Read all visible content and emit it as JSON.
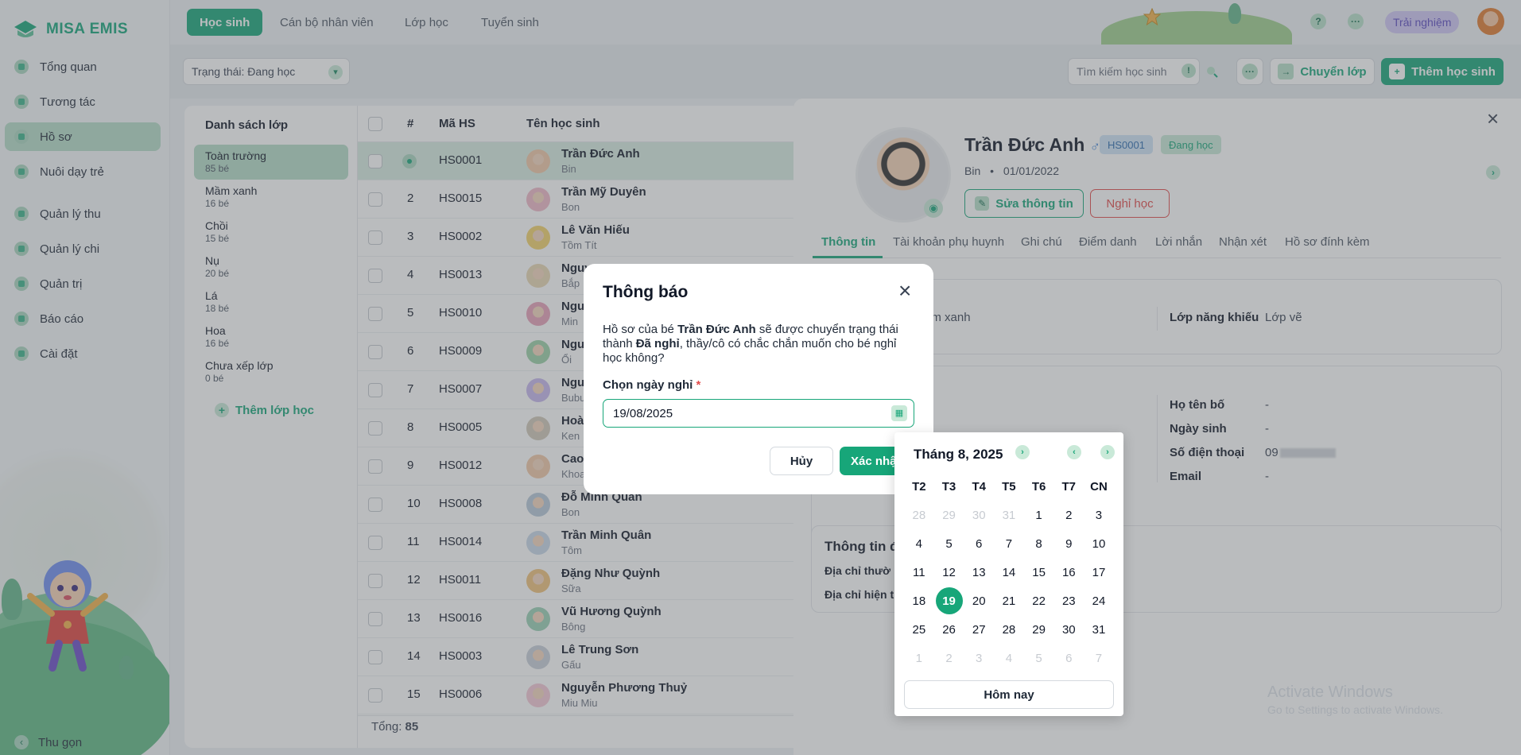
{
  "app": {
    "logo_text": "MISA EMIS"
  },
  "sidebar": {
    "items": [
      {
        "label": "Tổng quan",
        "icon": "dashboard-icon"
      },
      {
        "label": "Tương tác",
        "icon": "send-icon"
      },
      {
        "label": "Hồ sơ",
        "icon": "folder-icon"
      },
      {
        "label": "Nuôi dạy trẻ",
        "icon": "heart-icon"
      },
      {
        "label": "Quản lý thu",
        "icon": "income-icon"
      },
      {
        "label": "Quản lý chi",
        "icon": "wallet-icon"
      },
      {
        "label": "Quản trị",
        "icon": "briefcase-icon"
      },
      {
        "label": "Báo cáo",
        "icon": "report-icon"
      },
      {
        "label": "Cài đặt",
        "icon": "gear-icon"
      }
    ],
    "collapse_label": "Thu gọn"
  },
  "topbar": {
    "tabs": [
      "Học sinh",
      "Cán bộ nhân viên",
      "Lớp học",
      "Tuyển sinh"
    ],
    "help": "?",
    "more": "···",
    "trial": "Trải nghiệm"
  },
  "filter": {
    "status": "Trạng thái: Đang học",
    "search_placeholder": "Tìm kiếm học sinh",
    "more": "···",
    "move_class": "Chuyển lớp",
    "add_student": "Thêm học sinh"
  },
  "classes": {
    "title": "Danh sách lớp",
    "items": [
      {
        "name": "Toàn trường",
        "count": "85 bé"
      },
      {
        "name": "Mầm xanh",
        "count": "16 bé"
      },
      {
        "name": "Chồi",
        "count": "15 bé"
      },
      {
        "name": "Nụ",
        "count": "20 bé"
      },
      {
        "name": "Lá",
        "count": "18 bé"
      },
      {
        "name": "Hoa",
        "count": "16 bé"
      },
      {
        "name": "Chưa xếp lớp",
        "count": "0 bé"
      }
    ],
    "add_label": "Thêm lớp học"
  },
  "table": {
    "headers": {
      "no": "#",
      "code": "Mã HS",
      "name": "Tên học sinh"
    },
    "rows": [
      {
        "no": "",
        "code": "HS0001",
        "name": "Trần Đức Anh",
        "nick": "Bin"
      },
      {
        "no": "2",
        "code": "HS0015",
        "name": "Trần Mỹ Duyên",
        "nick": "Bon"
      },
      {
        "no": "3",
        "code": "HS0002",
        "name": "Lê Văn Hiếu",
        "nick": "Tồm Tít"
      },
      {
        "no": "4",
        "code": "HS0013",
        "name": "Nguy",
        "nick": "Bắp"
      },
      {
        "no": "5",
        "code": "HS0010",
        "name": "Ngu",
        "nick": "Min"
      },
      {
        "no": "6",
        "code": "HS0009",
        "name": "Ngu",
        "nick": "Ổi"
      },
      {
        "no": "7",
        "code": "HS0007",
        "name": "Ngu",
        "nick": "Bubu"
      },
      {
        "no": "8",
        "code": "HS0005",
        "name": "Hoà",
        "nick": "Ken"
      },
      {
        "no": "9",
        "code": "HS0012",
        "name": "Cao",
        "nick": "Khoa"
      },
      {
        "no": "10",
        "code": "HS0008",
        "name": "Đỗ Minh Quân",
        "nick": "Bon"
      },
      {
        "no": "11",
        "code": "HS0014",
        "name": "Trần Minh Quân",
        "nick": "Tôm"
      },
      {
        "no": "12",
        "code": "HS0011",
        "name": "Đặng Như Quỳnh",
        "nick": "Sữa"
      },
      {
        "no": "13",
        "code": "HS0016",
        "name": "Vũ Hương Quỳnh",
        "nick": "Bông"
      },
      {
        "no": "14",
        "code": "HS0003",
        "name": "Lê Trung Sơn",
        "nick": "Gấu"
      },
      {
        "no": "15",
        "code": "HS0006",
        "name": "Nguyễn Phương Thuỷ",
        "nick": "Miu Miu"
      }
    ],
    "total_label": "Tổng:",
    "total_value": "85"
  },
  "detail": {
    "name": "Trần Đức Anh",
    "gender_symbol": "♂",
    "code": "HS0001",
    "status": "Đang học",
    "nick": "Bin",
    "dob": "01/01/2022",
    "edit_label": "Sửa thông tin",
    "quit_label": "Nghỉ học",
    "tabs": [
      "Thông tin",
      "Tài khoản phụ huynh",
      "Ghi chú",
      "Điểm danh",
      "Lời nhắn",
      "Nhận xét",
      "Hồ sơ đính kèm"
    ],
    "class_partial": "ầm xanh",
    "talent_label": "Lớp năng khiếu",
    "talent_value": "Lớp vẽ",
    "father_label": "Họ tên bố",
    "father_value": "-",
    "birth_label": "Ngày sinh",
    "birth_value": "-",
    "phone_label": "Số điện thoại",
    "phone_value": "09",
    "email_label": "Email",
    "email_value": "-",
    "address_section": "Thông tin đ",
    "addr1": "Địa chỉ thườ",
    "addr2": "Địa chỉ hiện t"
  },
  "dialog": {
    "title": "Thông báo",
    "msg_1": "Hồ sơ của bé ",
    "msg_name": "Trần Đức Anh",
    "msg_2": " sẽ được chuyển trạng thái thành ",
    "msg_status": "Đã nghỉ",
    "msg_3": ", thầy/cô có chắc chắn muốn cho bé nghỉ học không?",
    "date_label": "Chọn ngày nghỉ",
    "required": "*",
    "date_value": "19/08/2025",
    "cancel": "Hủy",
    "confirm": "Xác nhận"
  },
  "calendar": {
    "title": "Tháng 8, 2025",
    "weekdays": [
      "T2",
      "T3",
      "T4",
      "T5",
      "T6",
      "T7",
      "CN"
    ],
    "days": [
      {
        "d": "28",
        "m": true
      },
      {
        "d": "29",
        "m": true
      },
      {
        "d": "30",
        "m": true
      },
      {
        "d": "31",
        "m": true
      },
      {
        "d": "1"
      },
      {
        "d": "2"
      },
      {
        "d": "3"
      },
      {
        "d": "4"
      },
      {
        "d": "5"
      },
      {
        "d": "6"
      },
      {
        "d": "7"
      },
      {
        "d": "8"
      },
      {
        "d": "9"
      },
      {
        "d": "10"
      },
      {
        "d": "11"
      },
      {
        "d": "12"
      },
      {
        "d": "13"
      },
      {
        "d": "14"
      },
      {
        "d": "15"
      },
      {
        "d": "16"
      },
      {
        "d": "17"
      },
      {
        "d": "18"
      },
      {
        "d": "19",
        "sel": true
      },
      {
        "d": "20"
      },
      {
        "d": "21"
      },
      {
        "d": "22"
      },
      {
        "d": "23"
      },
      {
        "d": "24"
      },
      {
        "d": "25"
      },
      {
        "d": "26"
      },
      {
        "d": "27"
      },
      {
        "d": "28"
      },
      {
        "d": "29"
      },
      {
        "d": "30"
      },
      {
        "d": "31"
      },
      {
        "d": "1",
        "m": true
      },
      {
        "d": "2",
        "m": true
      },
      {
        "d": "3",
        "m": true
      },
      {
        "d": "4",
        "m": true
      },
      {
        "d": "5",
        "m": true
      },
      {
        "d": "6",
        "m": true
      },
      {
        "d": "7",
        "m": true
      }
    ],
    "today": "Hôm nay"
  },
  "watermark": {
    "line1": "Activate Windows",
    "line2": "Go to Settings to activate Windows."
  },
  "colors": {
    "accent": "#17a679",
    "danger": "#e24b4b",
    "active_bg": "#b5dcc8"
  }
}
